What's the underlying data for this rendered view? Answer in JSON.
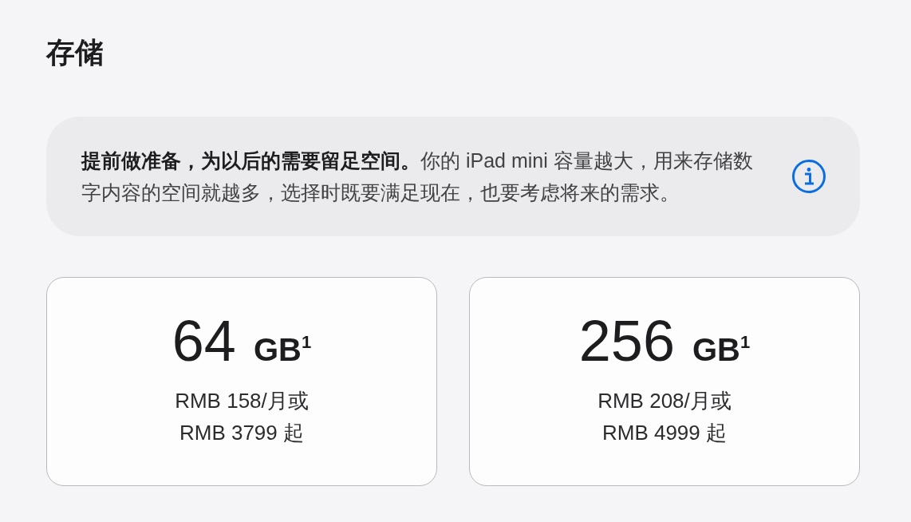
{
  "section": {
    "title": "存储"
  },
  "notice": {
    "text": "**提前做准备，为以后的需要留足空间。**你的 iPad mini 容量越大，用来存储数字内容的空间就越多，选择时既要满足现在，也要考虑将来的需求。"
  },
  "options": [
    {
      "number": "64",
      "unit": "GB",
      "footnote": "1",
      "price_lines": [
        "RMB 158/月或",
        "RMB 3799 起"
      ]
    },
    {
      "number": "256",
      "unit": "GB",
      "footnote": "1",
      "price_lines": [
        "RMB 208/月或",
        "RMB 4999 起"
      ]
    }
  ]
}
